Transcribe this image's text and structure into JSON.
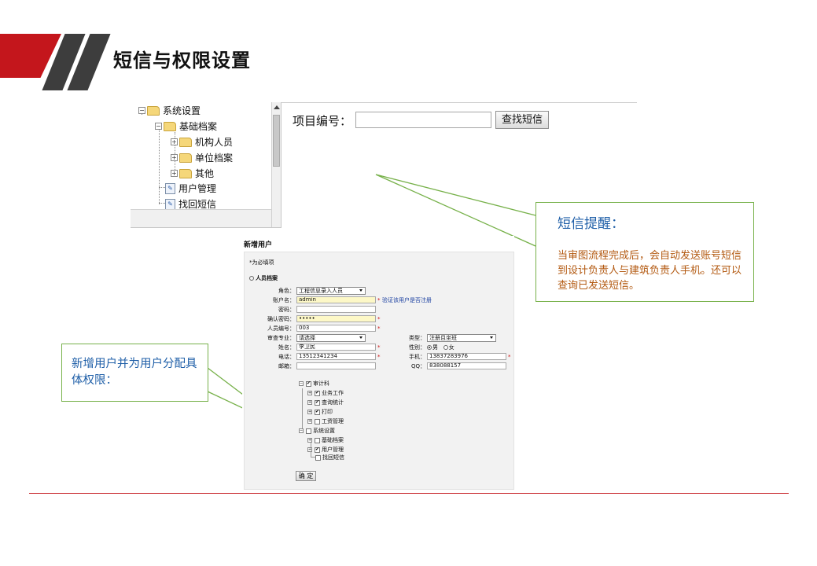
{
  "slide": {
    "title": "短信与权限设置",
    "accent_color": "#c4161c",
    "dark_color": "#3d3d3d"
  },
  "tree": {
    "nodes": [
      {
        "label": "系统设置",
        "icon": "folder-icon",
        "expander": "minus"
      },
      {
        "label": "基础档案",
        "icon": "folder-icon",
        "expander": "minus"
      },
      {
        "label": "机构人员",
        "icon": "folder-icon",
        "expander": "plus"
      },
      {
        "label": "单位档案",
        "icon": "folder-icon",
        "expander": "plus"
      },
      {
        "label": "其他",
        "icon": "folder-icon",
        "expander": "plus"
      },
      {
        "label": "用户管理",
        "icon": "page-icon",
        "expander": "none"
      },
      {
        "label": "找回短信",
        "icon": "page-icon",
        "expander": "none"
      }
    ]
  },
  "search": {
    "label": "项目编号：",
    "value": "",
    "button_label": "查找短信"
  },
  "callouts": {
    "sms_title": "短信提醒：",
    "sms_body": "当审图流程完成后，会自动发送账号短信到设计负责人与建筑负责人手机。还可以查询已发送短信。",
    "user_body": "新增用户并为用户分配具体权限：",
    "border_color": "#77b14a",
    "blue_color": "#1f5fa8",
    "orange_color": "#b35a12"
  },
  "form": {
    "title": "新增用户",
    "required_note": "*为必填项",
    "section_title": "人员档案",
    "fields": {
      "role": {
        "label": "角色：",
        "value": "工程信息录入人员"
      },
      "account": {
        "label": "账户名：",
        "value": "admin",
        "hint": "验证该用户是否注册"
      },
      "password": {
        "label": "密码：",
        "value": ""
      },
      "confirm_password": {
        "label": "确认密码：",
        "value": "•••••"
      },
      "staff_no": {
        "label": "人员编号：",
        "value": "003"
      },
      "specialty": {
        "label": "审查专业：",
        "value": "请选择"
      },
      "type": {
        "label": "类型：",
        "value": "注册且坐班"
      },
      "name": {
        "label": "姓名：",
        "value": "李卫民"
      },
      "gender": {
        "label": "性别：",
        "male": "男",
        "female": "女",
        "selected": "男"
      },
      "phone": {
        "label": "电话：",
        "value": "13512341234"
      },
      "mobile": {
        "label": "手机：",
        "value": "13837283976"
      },
      "email": {
        "label": "邮箱：",
        "value": ""
      },
      "qq": {
        "label": "QQ：",
        "value": "838088157"
      }
    },
    "permissions": [
      {
        "label": "审计科",
        "checked": true,
        "expander": "minus",
        "level": 0
      },
      {
        "label": "业务工作",
        "checked": true,
        "expander": "plus",
        "level": 1
      },
      {
        "label": "查询统计",
        "checked": true,
        "expander": "plus",
        "level": 1
      },
      {
        "label": "打印",
        "checked": true,
        "expander": "plus",
        "level": 1
      },
      {
        "label": "工资管理",
        "checked": false,
        "expander": "plus",
        "level": 1
      },
      {
        "label": "系统设置",
        "checked": false,
        "expander": "minus",
        "level": 0
      },
      {
        "label": "基础档案",
        "checked": false,
        "expander": "plus",
        "level": 1
      },
      {
        "label": "用户管理",
        "checked": true,
        "expander": "plus",
        "level": 1
      },
      {
        "label": "找回短信",
        "checked": false,
        "expander": "none",
        "level": 1
      }
    ],
    "submit_label": "确 定"
  }
}
